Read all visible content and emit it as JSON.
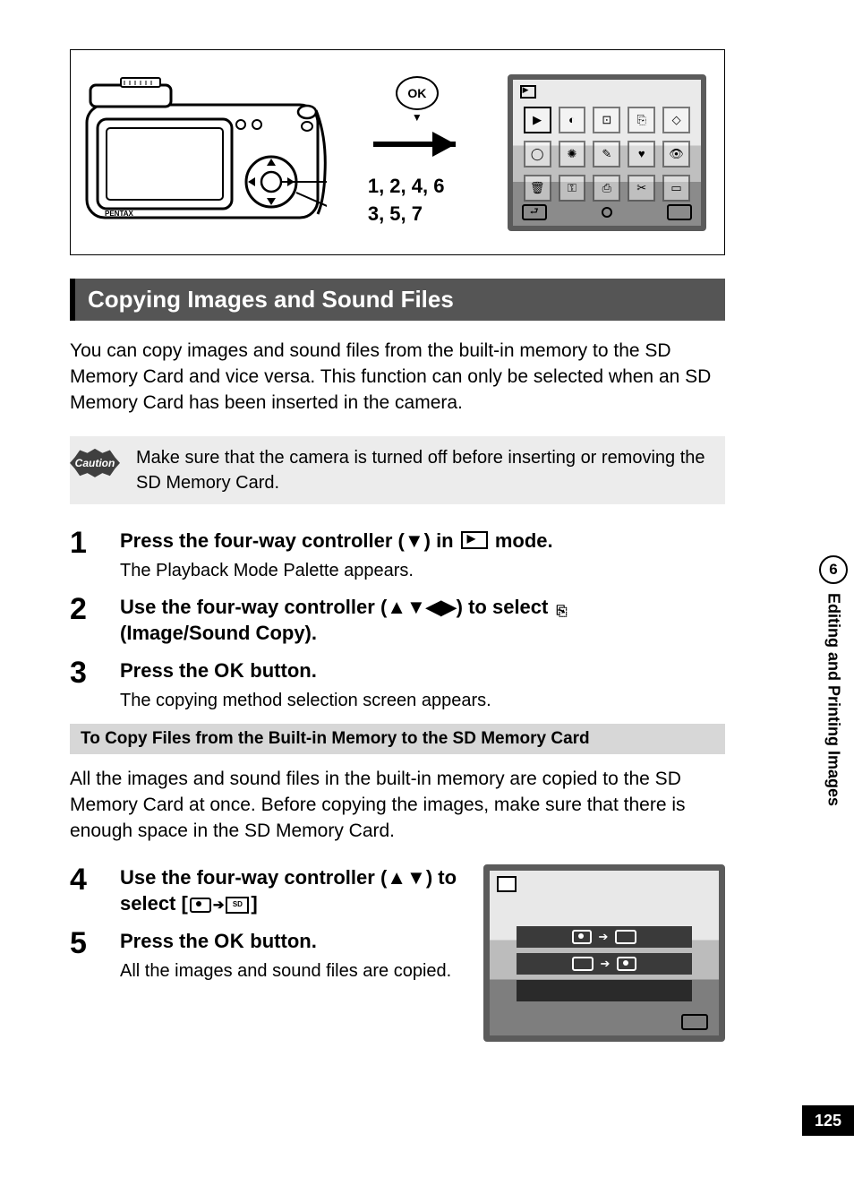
{
  "chapter": {
    "number": "6",
    "title": "Editing and Printing Images"
  },
  "page_number": "125",
  "diagram": {
    "ok_label": "OK",
    "lines": [
      "1, 2, 4, 6",
      "3, 5, 7"
    ],
    "camera_brand": "PENTAX"
  },
  "section_title": "Copying Images and Sound Files",
  "intro": "You can copy images and sound files from the built-in memory to the SD Memory Card and vice versa. This function can only be selected when an SD Memory Card has been inserted in the camera.",
  "caution": {
    "label": "Caution",
    "text": "Make sure that the camera is turned off before inserting or removing the SD Memory Card."
  },
  "steps_a": {
    "s1": {
      "n": "1",
      "title_pre": "Press the four-way controller (▼) in ",
      "title_post": " mode.",
      "sub": "The Playback Mode Palette appears."
    },
    "s2": {
      "n": "2",
      "title": "Use the four-way controller (▲▼◀▶) to select ",
      "title_post": " (Image/Sound Copy)."
    },
    "s3": {
      "n": "3",
      "title_pre": "Press the ",
      "ok": "OK",
      "title_post": " button.",
      "sub": "The copying method selection screen appears."
    }
  },
  "sub_heading": "To Copy Files from the Built-in Memory to the SD Memory Card",
  "sub_para": "All the images and sound files in the built-in memory are copied to the SD Memory Card at once. Before copying the images, make sure that there is enough space in the SD Memory Card.",
  "steps_b": {
    "s4": {
      "n": "4",
      "title_pre": "Use the four-way controller (▲▼) to select [",
      "title_post": "]",
      "sd_label": "SD"
    },
    "s5": {
      "n": "5",
      "title_pre": "Press the ",
      "ok": "OK",
      "title_post": " button.",
      "sub": "All the images and sound files are copied."
    }
  }
}
